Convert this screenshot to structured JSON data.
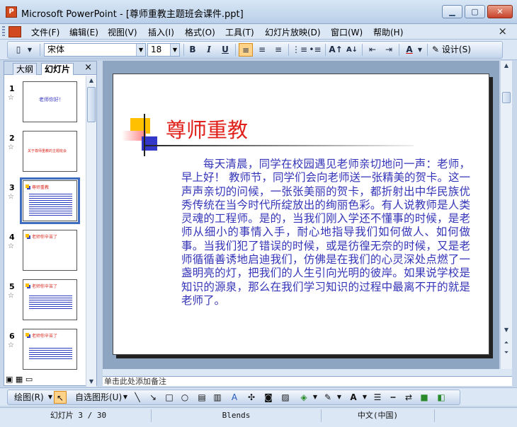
{
  "window": {
    "app_icon": "P",
    "title": "Microsoft PowerPoint - [尊师重教主题班会课件.ppt]",
    "buttons": {
      "minimize": "▁",
      "maximize": "▢",
      "close": "✕"
    }
  },
  "menubar": {
    "items": [
      "文件(F)",
      "编辑(E)",
      "视图(V)",
      "插入(I)",
      "格式(O)",
      "工具(T)",
      "幻灯片放映(D)",
      "窗口(W)",
      "帮助(H)"
    ],
    "close": "×"
  },
  "toolbar": {
    "font_name": "宋体",
    "font_size": "18",
    "bold": "B",
    "italic": "I",
    "underline": "U",
    "font_color_label": "A",
    "design_label": "设计(S)"
  },
  "left_panel": {
    "tabs": [
      "大纲",
      "幻灯片"
    ],
    "active_tab": "幻灯片",
    "close": "×",
    "thumbnails": [
      {
        "number": "1",
        "title": "老师你好！"
      },
      {
        "number": "2",
        "title": "关于尊师重教的主题班会"
      },
      {
        "number": "3",
        "title": "尊师重教"
      },
      {
        "number": "4",
        "title": "老师你辛苦了"
      },
      {
        "number": "5",
        "title": "老师你辛苦了"
      },
      {
        "number": "6",
        "title": "老师你辛苦了"
      }
    ],
    "selected_index": 2
  },
  "slide": {
    "title": "尊师重教",
    "body": "每天清晨，同学在校园遇见老师亲切地问一声：老师，早上好！ 教师节，同学们会向老师送一张精美的贺卡。这一声声亲切的问候，一张张美丽的贺卡，都折射出中华民族优秀传统在当今时代所绽放出的绚丽色彩。有人说教师是人类灵魂的工程师。是的，当我们刚入学还不懂事的时候，是老师从细小的事情入手，耐心地指导我们如何做人、如何做事。当我们犯了错误的时候，或是彷徨无奈的时候，又是老师循循善诱地启迪我们，仿佛是在我们的心灵深处点燃了一盏明亮的灯，把我们的人生引向光明的彼岸。如果说学校是知识的源泉，那么在我们学习知识的过程中最离不开的就是老师了。"
  },
  "notes": {
    "placeholder": "单击此处添加备注"
  },
  "drawing_toolbar": {
    "draw_label": "绘图(R)",
    "autoshapes_label": "自选图形(U)"
  },
  "statusbar": {
    "slide_position": "幻灯片 3 / 30",
    "design_template": "Blends",
    "language": "中文(中国)"
  },
  "colors": {
    "title_red": "#e0201a",
    "body_blue": "#3434b8",
    "accent_yellow": "#ffc000"
  }
}
